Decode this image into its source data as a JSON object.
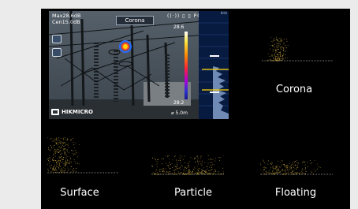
{
  "device_screen": {
    "readout_max": "Max28.6dB",
    "readout_cen": "Cen15.0dB",
    "mode_title": "Corona",
    "scale_max": "28.6",
    "scale_min": "28.2",
    "distance": "5.0m",
    "status_icons": "((·)) ▯ ▯ P0",
    "brand": "HIKMICRO",
    "spectrum_unit": "kHz"
  },
  "panels": [
    {
      "id": "corona",
      "label": "Corona"
    },
    {
      "id": "surface",
      "label": "Surface"
    },
    {
      "id": "particle",
      "label": "Particle"
    },
    {
      "id": "floating",
      "label": "Floating"
    }
  ],
  "colors": {
    "page_bg": "#ebebeb",
    "frame_bg": "#000000",
    "dot_color": "#e8c24a",
    "baseline": "#cfcfcf",
    "accent_yellow": "#ffd400"
  }
}
